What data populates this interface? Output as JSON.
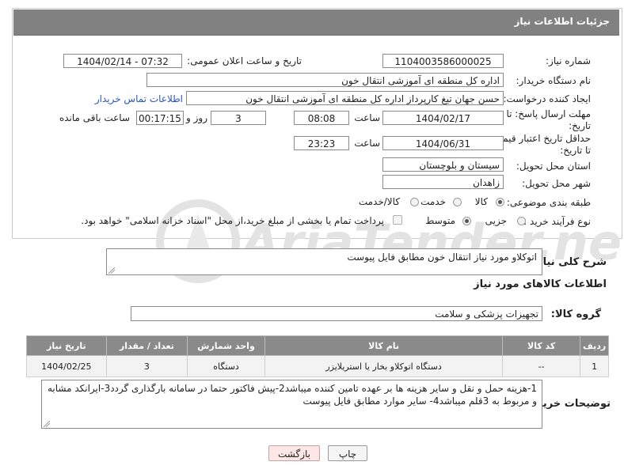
{
  "header": {
    "title": "جزئیات اطلاعات نیاز"
  },
  "fields": {
    "need_number_label": "شماره نیاز:",
    "need_number": "1104003586000025",
    "announce_label": "تاریخ و ساعت اعلان عمومی:",
    "announce_value": "1404/02/14 - 07:32",
    "buyer_org_label": "نام دستگاه خریدار:",
    "buyer_org": "اداره کل منطقه ای آموزشی انتقال خون",
    "creator_label": "ایجاد کننده درخواست:",
    "creator": "حسن جهان تیغ کارپرداز اداره کل منطقه ای آموزشی انتقال خون",
    "contact_link": "اطلاعات تماس خریدار",
    "deadline_label_1": "مهلت ارسال پاسخ: تا",
    "deadline_label_2": "تاریخ:",
    "deadline_date": "1404/02/17",
    "time_label": "ساعت",
    "deadline_time": "08:08",
    "days_value": "3",
    "days_label": "روز و",
    "remaining_time": "00:17:15",
    "remaining_label": "ساعت باقی مانده",
    "validity_label_1": "حداقل تاریخ اعتبار قیمت:",
    "validity_label_2": "تا تاریخ:",
    "validity_date": "1404/06/31",
    "validity_time": "23:23",
    "province_label": "استان محل تحویل:",
    "province": "سیستان و بلوچستان",
    "city_label": "شهر محل تحویل:",
    "city": "زاهدان",
    "category_label": "طبقه بندی موضوعی:",
    "category_options": [
      "کالا",
      "خدمت",
      "کالا/خدمت"
    ],
    "process_label": "نوع فرآیند خرید :",
    "process_options": [
      "جزیی",
      "متوسط"
    ],
    "payment_note": "پرداخت تمام یا بخشی از مبلغ خرید،از محل \"اسناد خزانه اسلامی\" خواهد بود."
  },
  "description": {
    "label": "شرح کلی نیاز:",
    "value": "اتوکلاو مورد نیاز انتقال خون مطابق فایل پیوست"
  },
  "goods": {
    "section_title": "اطلاعات کالاهای مورد نیاز",
    "group_label": "گروه کالا:",
    "group_value": "تجهیزات پزشکی و سلامت",
    "columns": [
      "ردیف",
      "کد کالا",
      "نام کالا",
      "واحد شمارش",
      "تعداد / مقدار",
      "تاریخ نیاز"
    ],
    "rows": [
      [
        "1",
        "--",
        "دستگاه اتوکلاو بخار یا استریلایزر",
        "دستگاه",
        "3",
        "1404/02/25"
      ]
    ]
  },
  "buyer_notes": {
    "label": "توضیحات خریدار:",
    "value": "1-هزینه حمل و نقل و سایر هزینه ها  بر عهده تامین کننده میباشد2-پیش فاکتور حتما در سامانه بارگذاری گردد3-ایرانکد مشابه و مربوط به 3قلم میباشد4- سایر موارد مطابق فایل پیوست"
  },
  "buttons": {
    "print": "چاپ",
    "back": "بازگشت"
  },
  "watermark_text": "AriaTender.neT"
}
